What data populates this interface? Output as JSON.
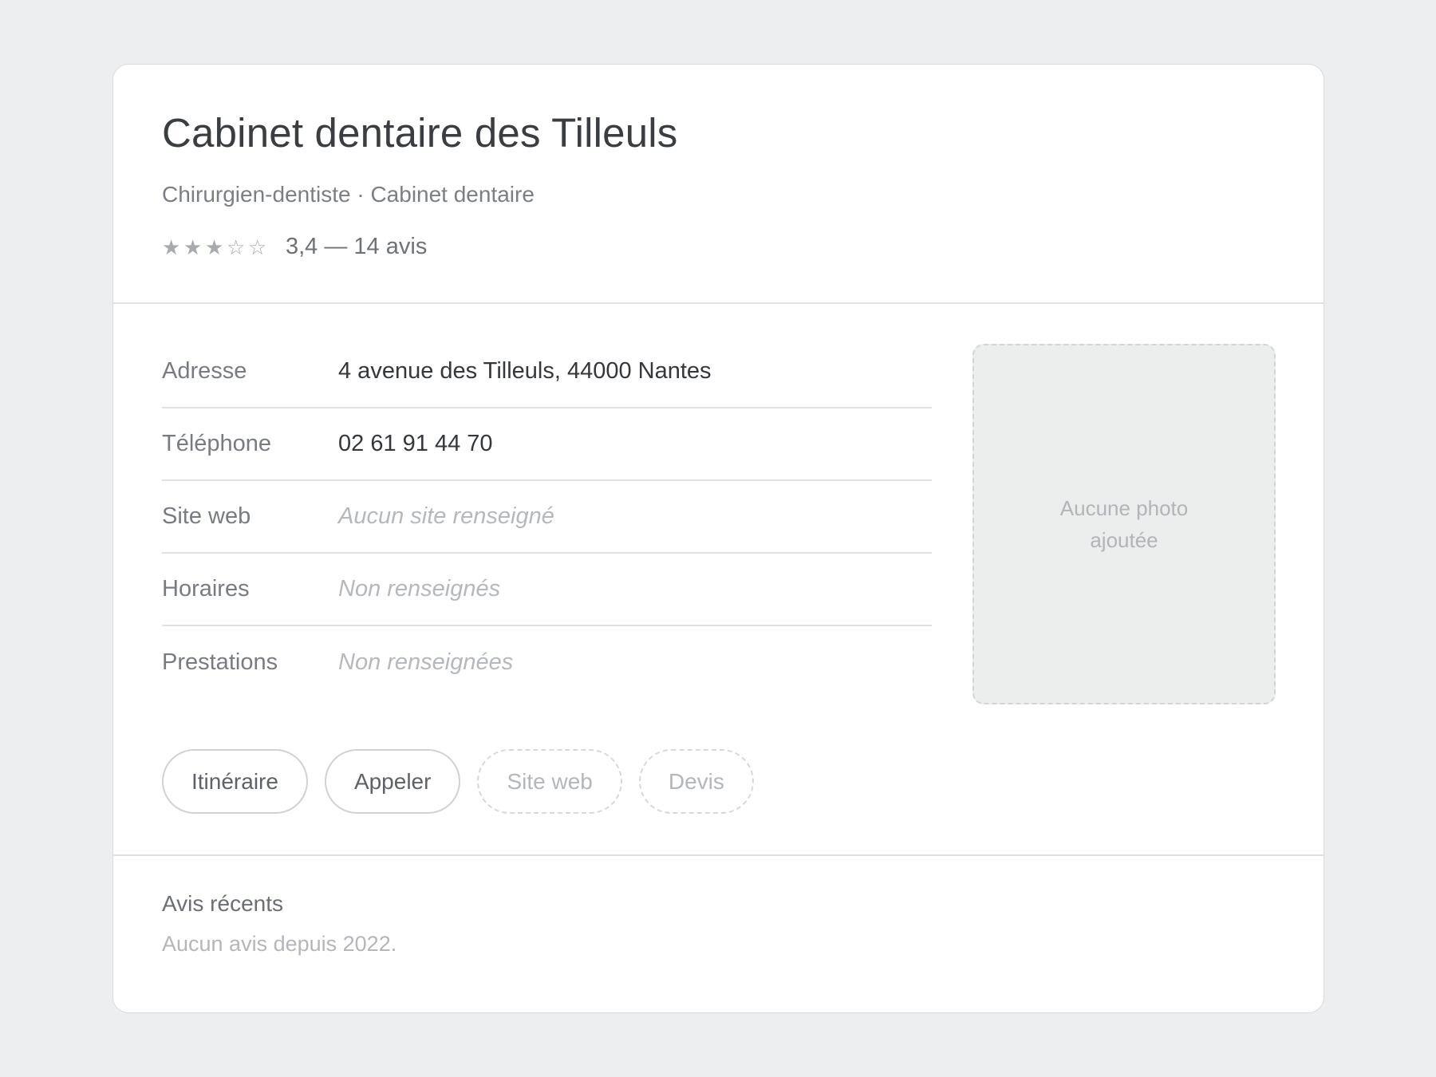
{
  "business": {
    "name": "Cabinet dentaire des Tilleuls",
    "categories": "Chirurgien-dentiste · Cabinet dentaire",
    "rating": {
      "score": 3.4,
      "max": 5,
      "stars": [
        "★",
        "★",
        "★",
        "☆",
        "☆"
      ],
      "text": "3,4 — 14 avis"
    }
  },
  "info": {
    "rows": [
      {
        "label": "Adresse",
        "value": "4 avenue des Tilleuls, 44000 Nantes",
        "empty": false
      },
      {
        "label": "Téléphone",
        "value": "02 61 91 44 70",
        "empty": false
      },
      {
        "label": "Site web",
        "value": "Aucun site renseigné",
        "empty": true
      },
      {
        "label": "Horaires",
        "value": "Non renseignés",
        "empty": true
      },
      {
        "label": "Prestations",
        "value": "Non renseignées",
        "empty": true
      }
    ]
  },
  "photo": {
    "placeholder": "Aucune photo ajoutée"
  },
  "actions": {
    "itinerary": "Itinéraire",
    "call": "Appeler",
    "website": "Site web",
    "quote": "Devis"
  },
  "reviews": {
    "title": "Avis récents",
    "empty": "Aucun avis depuis 2022."
  },
  "colors": {
    "background": "#edeef0",
    "card": "#ffffff",
    "text_primary": "#3a3d41",
    "text_muted": "#7b7f85",
    "text_placeholder": "#b5b8bc",
    "border": "#dfe1e4"
  }
}
